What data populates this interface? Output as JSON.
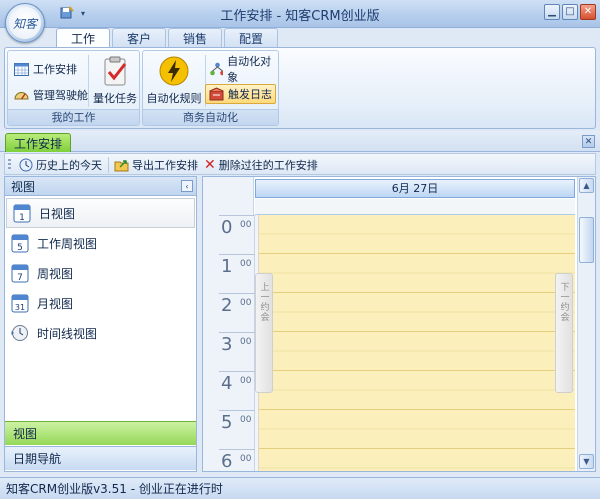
{
  "window": {
    "title": "工作安排 - 知客CRM创业版",
    "orb_text": "知客"
  },
  "ribbon_tabs": [
    {
      "label": "工作",
      "active": true
    },
    {
      "label": "客户",
      "active": false
    },
    {
      "label": "销售",
      "active": false
    },
    {
      "label": "配置",
      "active": false
    }
  ],
  "ribbon": {
    "group_my_work": {
      "label": "我的工作",
      "work_schedule": "工作安排",
      "cockpit": "管理驾驶舱",
      "quantify_task": "量化任务"
    },
    "group_automation": {
      "label": "商务自动化",
      "auto_rules": "自动化规则",
      "auto_objects": "自动化对象",
      "trigger_log": "触发日志"
    }
  },
  "doc_tab": {
    "label": "工作安排"
  },
  "toolbar": {
    "today": "历史上的今天",
    "export": "导出工作安排",
    "delete_past": "删除过往的工作安排"
  },
  "navpane": {
    "header": "视图",
    "items": [
      {
        "label": "日视图",
        "icon_num": "1"
      },
      {
        "label": "工作周视图",
        "icon_num": "5"
      },
      {
        "label": "周视图",
        "icon_num": "7"
      },
      {
        "label": "月视图",
        "icon_num": "31"
      },
      {
        "label": "时间线视图",
        "icon_num": ""
      }
    ],
    "bottom_views": "视图",
    "bottom_datenav": "日期导航"
  },
  "calendar": {
    "date_header": "6月 27日",
    "hours": [
      "0",
      "1",
      "2",
      "3",
      "4",
      "5",
      "6"
    ],
    "hour_suffix": "00",
    "prev_label": "上一约会",
    "next_label": "下一约会"
  },
  "status": {
    "text": "知客CRM创业版v3.51 - 创业正在进行时"
  },
  "colors": {
    "accent_green": "#7fcf3b",
    "slot_yellow": "#fbf0bb",
    "chrome_blue": "#c0d5ef"
  }
}
